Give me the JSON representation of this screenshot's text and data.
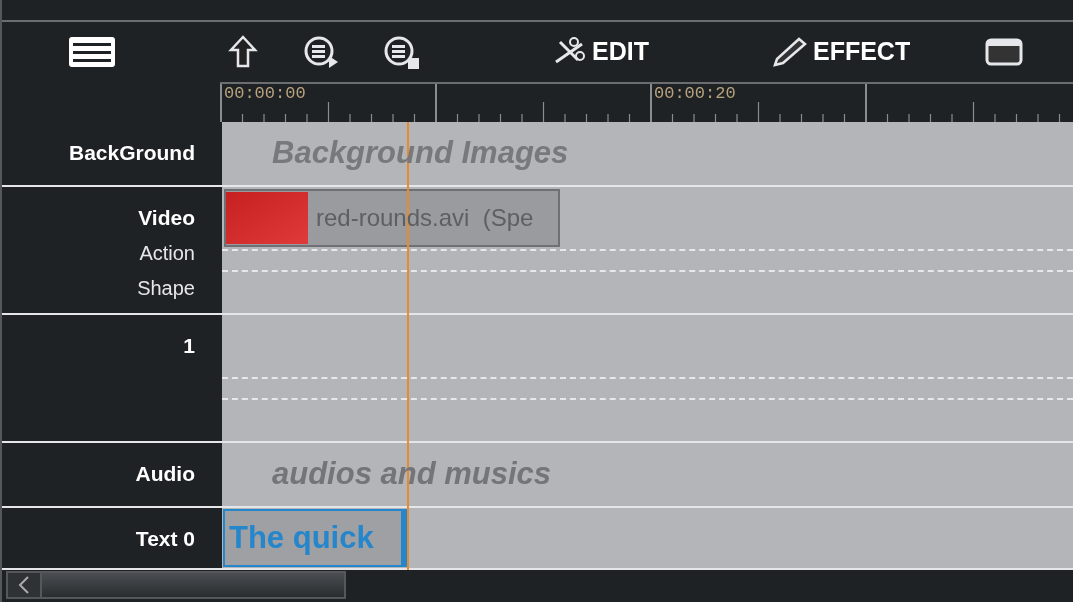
{
  "toolbar": {
    "buttons": [
      {
        "kind": "up"
      },
      {
        "kind": "play"
      },
      {
        "kind": "stop"
      },
      {
        "kind": "edit",
        "label": "EDIT"
      },
      {
        "kind": "effect",
        "label": "EFFECT"
      },
      {
        "kind": "window"
      }
    ]
  },
  "ruler": {
    "labels": [
      "00:00:00",
      "00:00:20"
    ]
  },
  "tracks": [
    {
      "kind": "background",
      "labels": [
        "BackGround"
      ],
      "placeholder": "Background Images"
    },
    {
      "kind": "video",
      "labels": [
        "Video",
        "Action",
        "Shape"
      ],
      "clip": {
        "name": "red-rounds.avi  (Spe"
      }
    },
    {
      "kind": "overlay",
      "labels": [
        "1"
      ]
    },
    {
      "kind": "audio",
      "labels": [
        "Audio"
      ],
      "placeholder": "audios and musics"
    },
    {
      "kind": "text",
      "labels": [
        "Text 0"
      ],
      "clip": {
        "name": "The quick",
        "selected": true
      }
    }
  ]
}
